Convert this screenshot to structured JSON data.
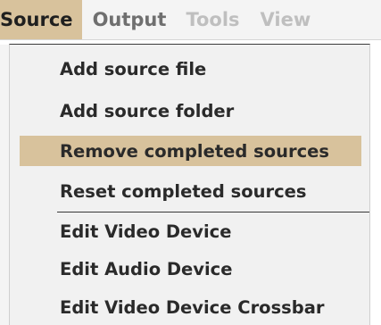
{
  "menubar": {
    "items": [
      {
        "label": "Source",
        "state": "active"
      },
      {
        "label": "Output",
        "state": "enabled"
      },
      {
        "label": "Tools",
        "state": "disabled"
      },
      {
        "label": "View",
        "state": "disabled"
      }
    ]
  },
  "dropdown": {
    "groups": [
      [
        {
          "label": "Add source file"
        },
        {
          "label": "Add source folder"
        },
        {
          "label": "Remove completed sources",
          "highlighted": true
        },
        {
          "label": "Reset completed sources"
        }
      ],
      [
        {
          "label": "Edit Video Device"
        },
        {
          "label": "Edit Audio Device"
        },
        {
          "label": "Edit Video Device Crossbar"
        }
      ]
    ]
  },
  "colors": {
    "highlight": "#d8c29c",
    "menu_background": "#f1f1f1",
    "text": "#2a2a2a",
    "disabled_text": "#bfbfbf"
  }
}
